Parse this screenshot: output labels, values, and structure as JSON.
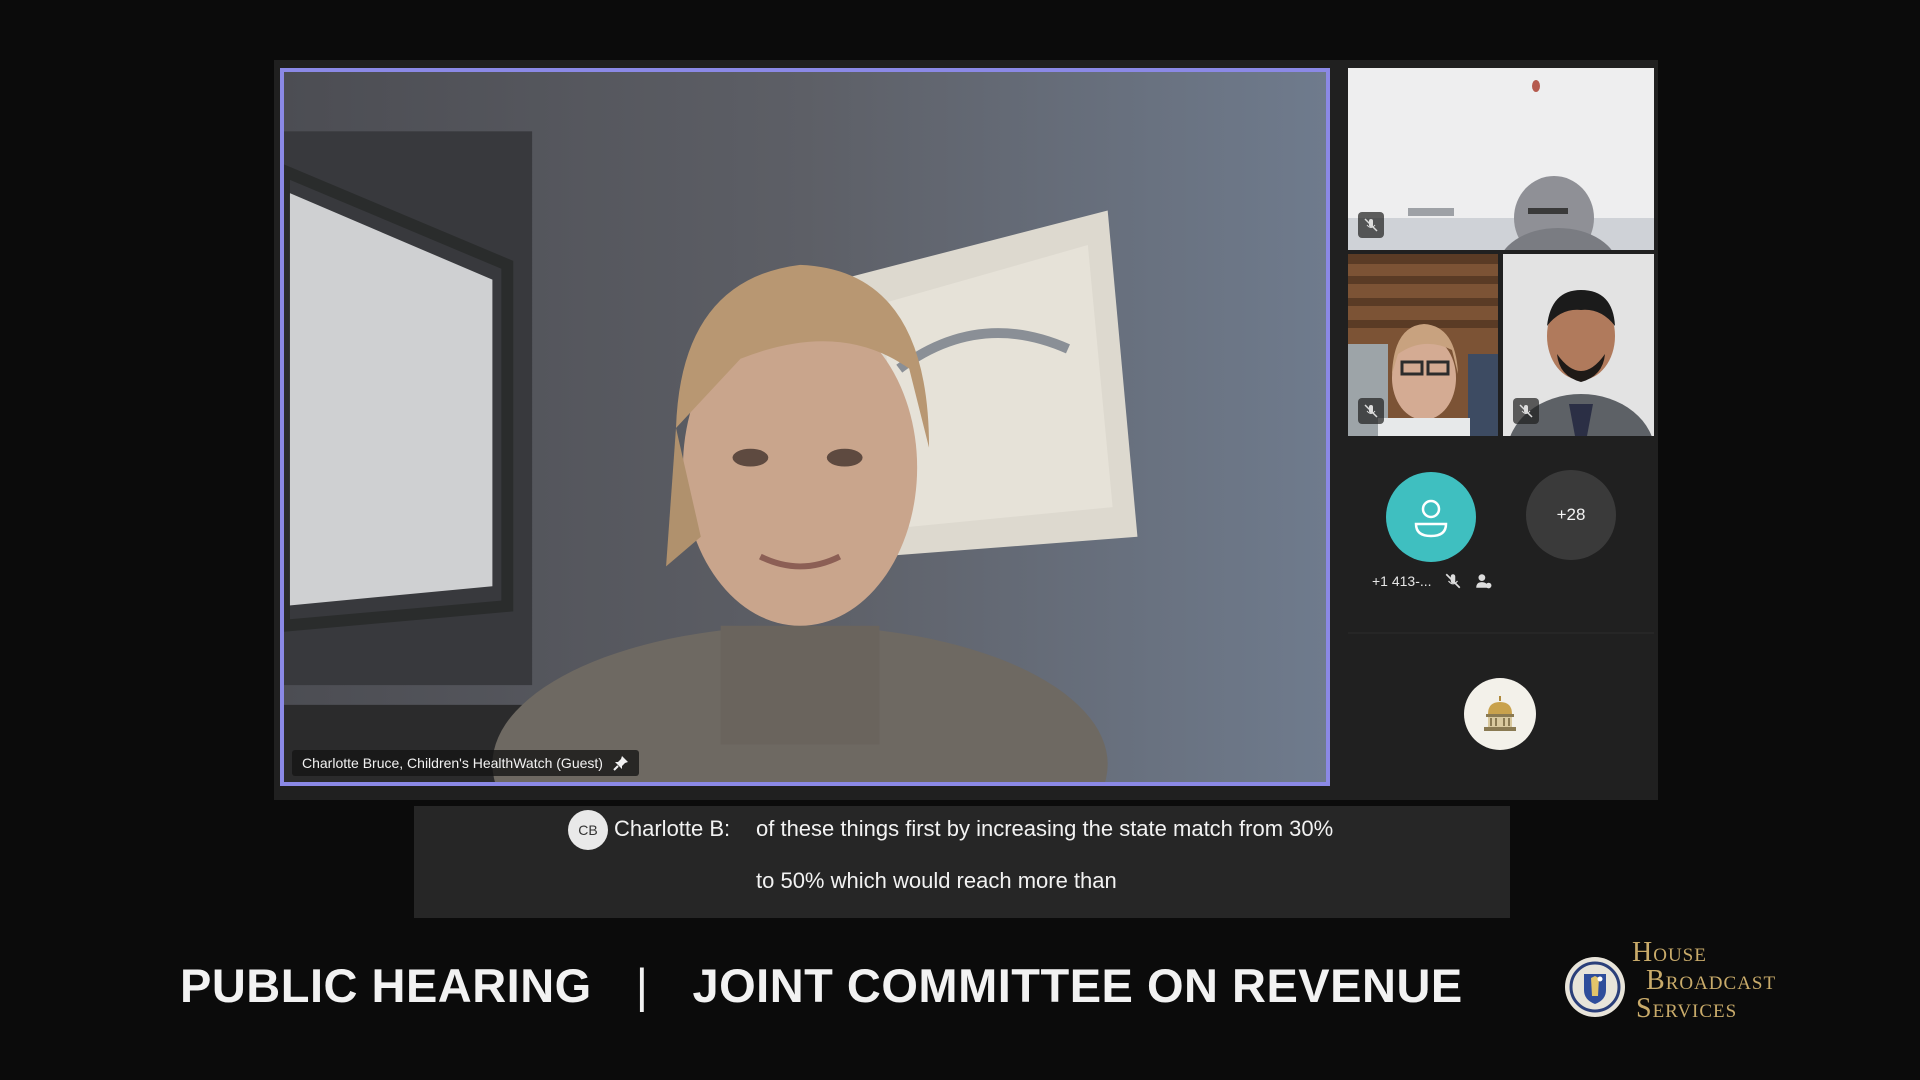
{
  "main_speaker": {
    "name": "Charlotte Bruce, Children's HealthWatch (Guest)"
  },
  "roster": {
    "phone_participant": "+1 413-...",
    "more_count": "+28"
  },
  "captions": {
    "initials": "CB",
    "speaker": "Charlotte B:",
    "line1": "of these things first by increasing the state match from 30%",
    "line2": "to 50% which would reach more than"
  },
  "banner": {
    "left": "PUBLIC HEARING",
    "separator": "|",
    "right": "JOINT COMMITTEE ON REVENUE"
  },
  "brand": {
    "line1_cap": "H",
    "line1_rest": "OUSE",
    "line2_cap": "B",
    "line2_rest": "ROADCAST",
    "line3_cap": "S",
    "line3_rest": "ERVICES"
  },
  "colors": {
    "active_speaker_border": "#8b89e6",
    "avatar_bg": "#3fbfc0",
    "brand_gold": "#c9ab6a"
  }
}
